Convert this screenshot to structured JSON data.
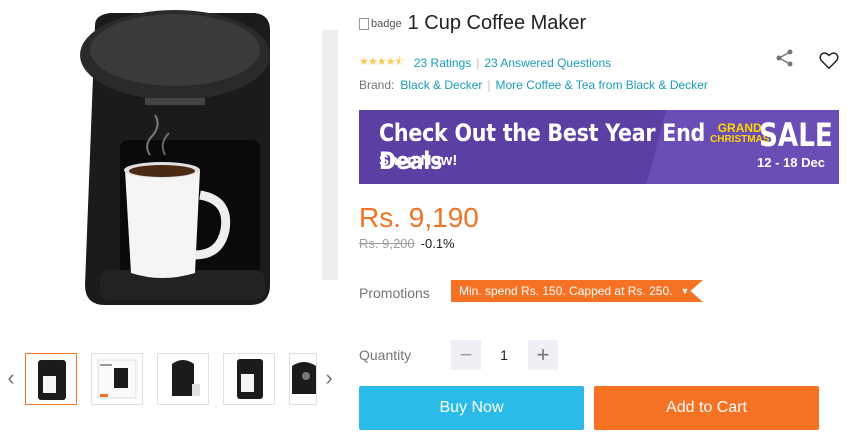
{
  "product": {
    "title": "1 Cup Coffee Maker",
    "badge_alt": "badge",
    "ratings_text": "23 Ratings",
    "answered_text": "23 Answered Questions",
    "brand_label": "Brand:",
    "brand_name": "Black & Decker",
    "more_from": "More Coffee & Tea from Black & Decker",
    "star_rating": 4.5
  },
  "banner": {
    "headline": "Check Out the Best Year End Deals",
    "subline": "Shop Now!",
    "grand": "GRAND",
    "christmas": "CHRISTMAS",
    "sale": "SALE",
    "dates": "12 - 18 Dec"
  },
  "pricing": {
    "price": "Rs. 9,190",
    "old_price": "Rs. 9,200",
    "discount": "-0.1%"
  },
  "promotions": {
    "label": "Promotions",
    "tag": "Min. spend Rs. 150. Capped at Rs. 250."
  },
  "quantity": {
    "label": "Quantity",
    "value": "1",
    "minus": "−",
    "plus": "+"
  },
  "actions": {
    "buy_now": "Buy Now",
    "add_to_cart": "Add to Cart"
  },
  "gallery": {
    "prev": "‹",
    "next": "›",
    "active_index": 0
  },
  "colors": {
    "accent_orange": "#f57224",
    "buy_blue": "#2abbe8",
    "link": "#1a9cb7",
    "banner_purple": "#5b3fa3"
  },
  "icons": [
    "share-icon",
    "heart-icon",
    "chevron-left-icon",
    "chevron-right-icon"
  ]
}
